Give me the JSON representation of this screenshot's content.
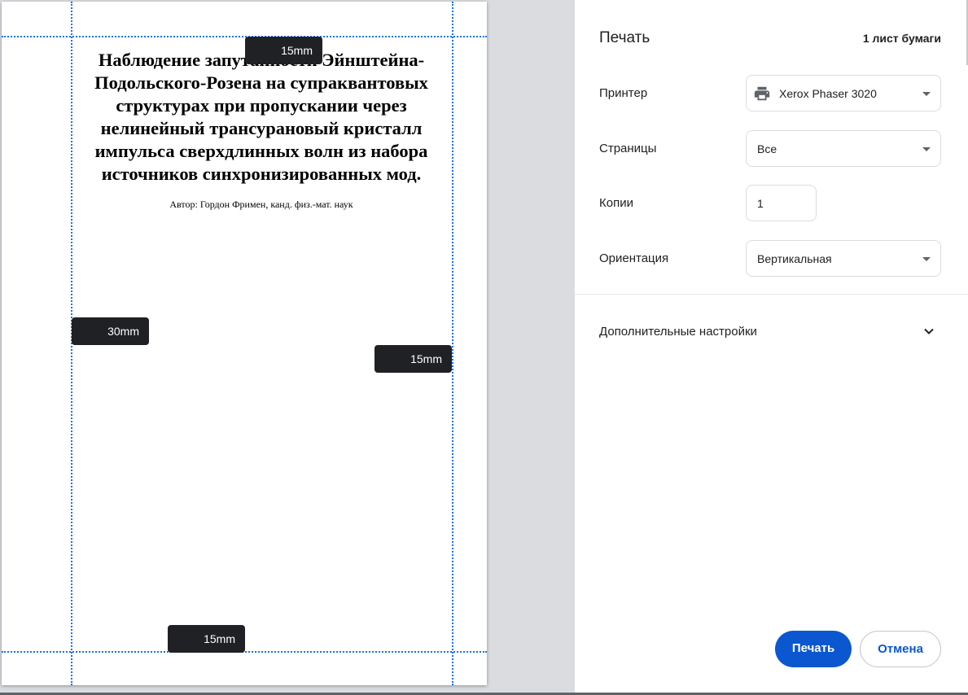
{
  "preview": {
    "document_title": "Наблюдение запутанности Эйнштейна-Подольского-Розена на супраквантовых структурах при пропускании через нелинейный трансурановый кристалл импульса сверхдлинных волн из набора источников синхронизированных мод.",
    "document_author": "Автор: Гордон Фримен, канд. физ.-мат. наук",
    "margins": {
      "top": "15mm",
      "left": "30mm",
      "right": "15mm",
      "bottom": "15mm"
    }
  },
  "settings": {
    "title": "Печать",
    "sheet_count": "1 лист бумаги",
    "printer": {
      "label": "Принтер",
      "value": "Xerox Phaser 3020",
      "icon": "printer-icon"
    },
    "pages": {
      "label": "Страницы",
      "value": "Все"
    },
    "copies": {
      "label": "Копии",
      "value": "1"
    },
    "orientation": {
      "label": "Ориентация",
      "value": "Вертикальная"
    },
    "more_settings": {
      "label": "Дополнительные настройки",
      "icon": "chevron-down-icon"
    },
    "print_button": "Печать",
    "cancel_button": "Отмена"
  },
  "colors": {
    "accent": "#0b57d0",
    "guide": "#1a73e8",
    "margin_tag_bg": "#202124",
    "preview_bg": "#dadce0"
  }
}
